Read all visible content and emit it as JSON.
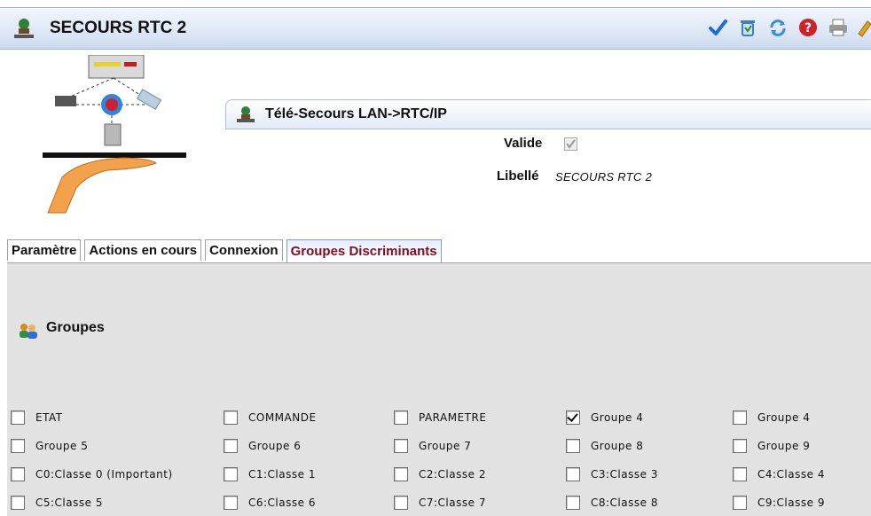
{
  "window": {
    "title": "SECOURS RTC 2"
  },
  "toolbar": {
    "buttons": [
      {
        "icon": "checkmark-icon",
        "color": "#1a6fd6"
      },
      {
        "icon": "trash-icon",
        "color": "#3e7fbf"
      },
      {
        "icon": "refresh-icon",
        "color": "#3d8fd4"
      },
      {
        "icon": "help-icon",
        "color": "#d0202a"
      },
      {
        "icon": "print-icon",
        "color": "#888888"
      },
      {
        "icon": "edit-icon",
        "color": "#e0a020"
      }
    ]
  },
  "section": {
    "title": "Télé-Secours LAN->RTC/IP"
  },
  "fields": {
    "valide_label": "Valide",
    "valide_checked": true,
    "libelle_label": "Libellé",
    "libelle_value": "SECOURS RTC 2"
  },
  "tabs": [
    {
      "label": "Paramètre",
      "active": false
    },
    {
      "label": "Actions en cours",
      "active": false
    },
    {
      "label": "Connexion",
      "active": false
    },
    {
      "label": "Groupes Discriminants",
      "active": true
    }
  ],
  "groups": {
    "title": "Groupes",
    "items": [
      {
        "label": "ETAT",
        "checked": false
      },
      {
        "label": "COMMANDE",
        "checked": false
      },
      {
        "label": "PARAMETRE",
        "checked": false
      },
      {
        "label": "Groupe 4",
        "checked": true
      },
      {
        "label": "Groupe 4",
        "checked": false
      },
      {
        "label": "Groupe 5",
        "checked": false
      },
      {
        "label": "Groupe 6",
        "checked": false
      },
      {
        "label": "Groupe 7",
        "checked": false
      },
      {
        "label": "Groupe 8",
        "checked": false
      },
      {
        "label": "Groupe 9",
        "checked": false
      },
      {
        "label": "C0:Classe 0 (Important)",
        "checked": false
      },
      {
        "label": "C1:Classe 1",
        "checked": false
      },
      {
        "label": "C2:Classe 2",
        "checked": false
      },
      {
        "label": "C3:Classe 3",
        "checked": false
      },
      {
        "label": "C4:Classe 4",
        "checked": false
      },
      {
        "label": "C5:Classe 5",
        "checked": false
      },
      {
        "label": "C6:Classe 6",
        "checked": false
      },
      {
        "label": "C7:Classe 7",
        "checked": false
      },
      {
        "label": "C8:Classe 8",
        "checked": false
      },
      {
        "label": "C9:Classe 9",
        "checked": false
      }
    ]
  }
}
